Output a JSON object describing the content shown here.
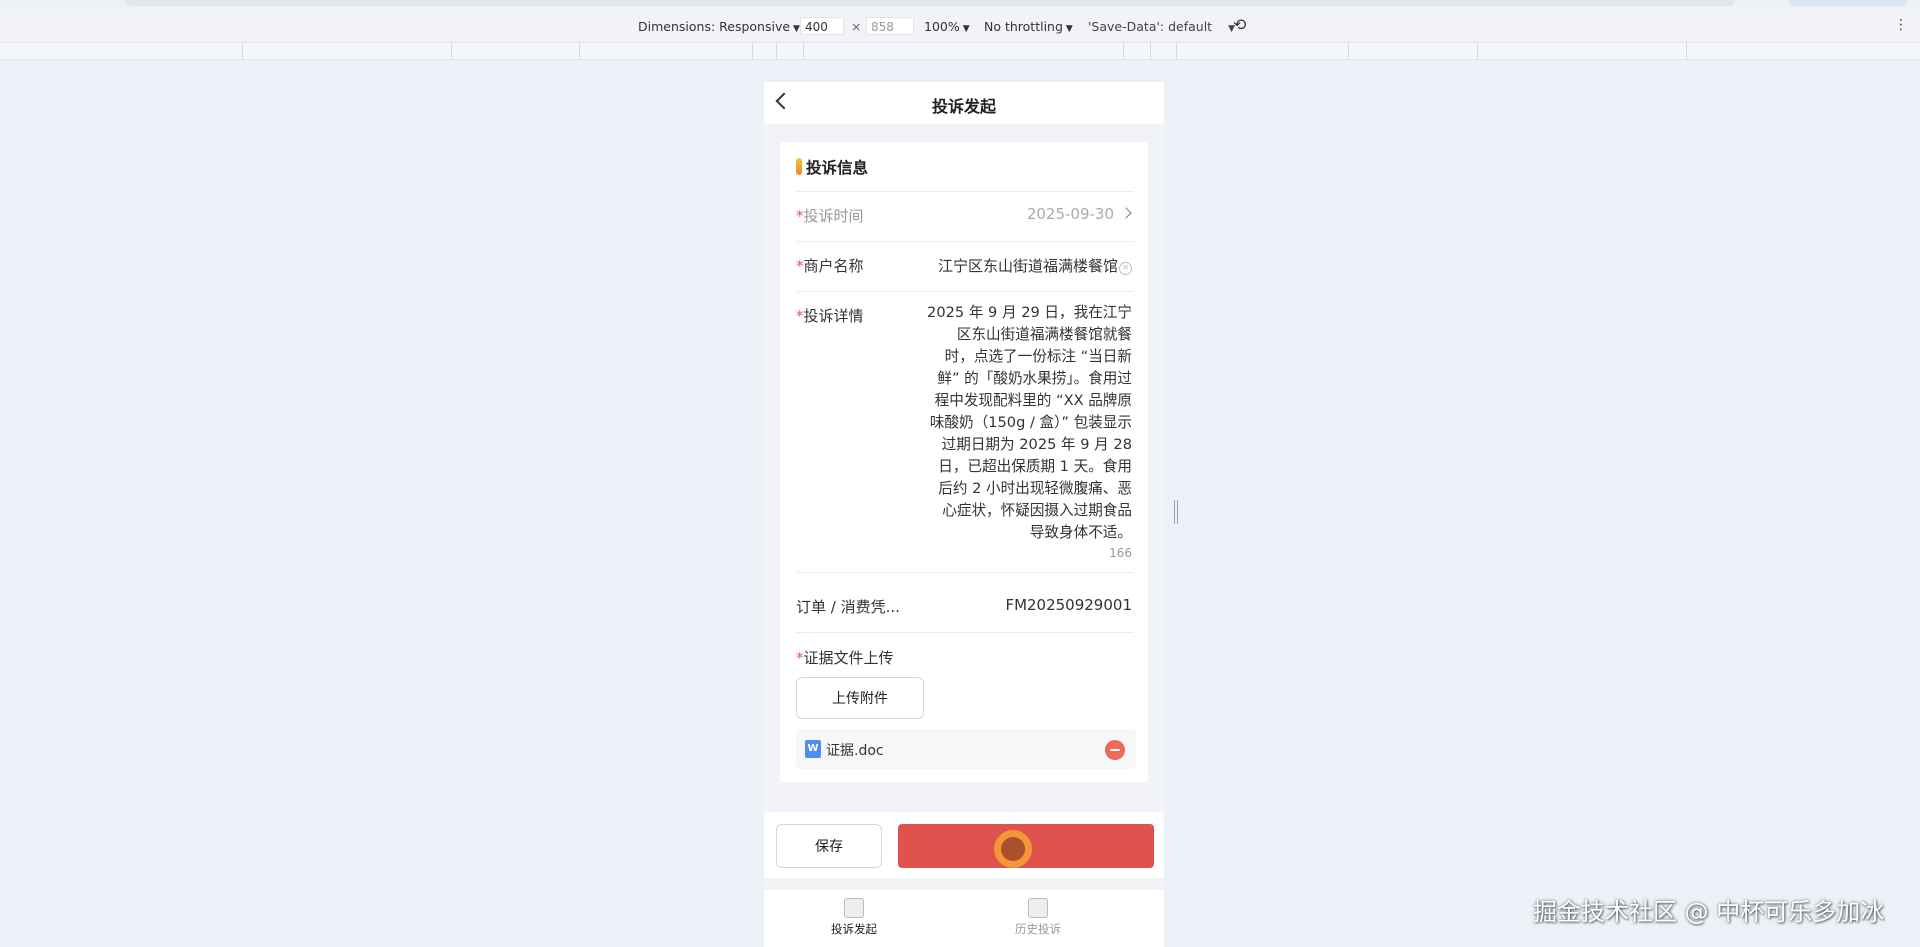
{
  "devtools": {
    "dimensions_label": "Dimensions: Responsive",
    "width": "400",
    "times": "×",
    "height": "858",
    "zoom": "100%",
    "throttling": "No throttling",
    "save_data": "'Save-Data': default"
  },
  "header": {
    "title": "投诉发起"
  },
  "section": {
    "title": "投诉信息"
  },
  "fields": {
    "time": {
      "required": "*",
      "label": "投诉时间",
      "value": "2025-09-30"
    },
    "merchant": {
      "required": "*",
      "label": "商户名称",
      "value": "江宁区东山街道福满楼餐馆"
    },
    "detail": {
      "required": "*",
      "label": "投诉详情",
      "lines": [
        "2025 年 9 月 29 日，我在江宁",
        "区东山街道福满楼餐馆就餐",
        "时，点选了一份标注 “当日新",
        "鲜” 的「酸奶水果捞」。食用过",
        "程中发现配料里的 “XX 品牌原",
        "味酸奶（150g / 盒）” 包装显示",
        "过期日期为 2025 年 9 月 28",
        "日，已超出保质期 1 天。食用",
        "后约 2 小时出现轻微腹痛、恶",
        "心症状，怀疑因摄入过期食品",
        "导致身体不适。"
      ],
      "count": "166"
    },
    "order": {
      "label": "订单 / 消费凭...",
      "value": "FM20250929001"
    },
    "evidence": {
      "required": "*",
      "label": "证据文件上传",
      "upload_label": "上传附件",
      "file_name": "证据.doc",
      "file_icon_letter": "W"
    }
  },
  "footer": {
    "save_label": "保存",
    "submit_label": ""
  },
  "tabbar": {
    "tab_submit": "投诉发起",
    "tab_history": "历史投诉"
  },
  "watermark": "掘金技术社区 @ 中杯可乐多加冰",
  "colors": {
    "primary": "#e0524c",
    "required": "#e2534b",
    "accent_bar": "#f5c242",
    "file_icon": "#4f8df0",
    "remove": "#ee6a58"
  }
}
